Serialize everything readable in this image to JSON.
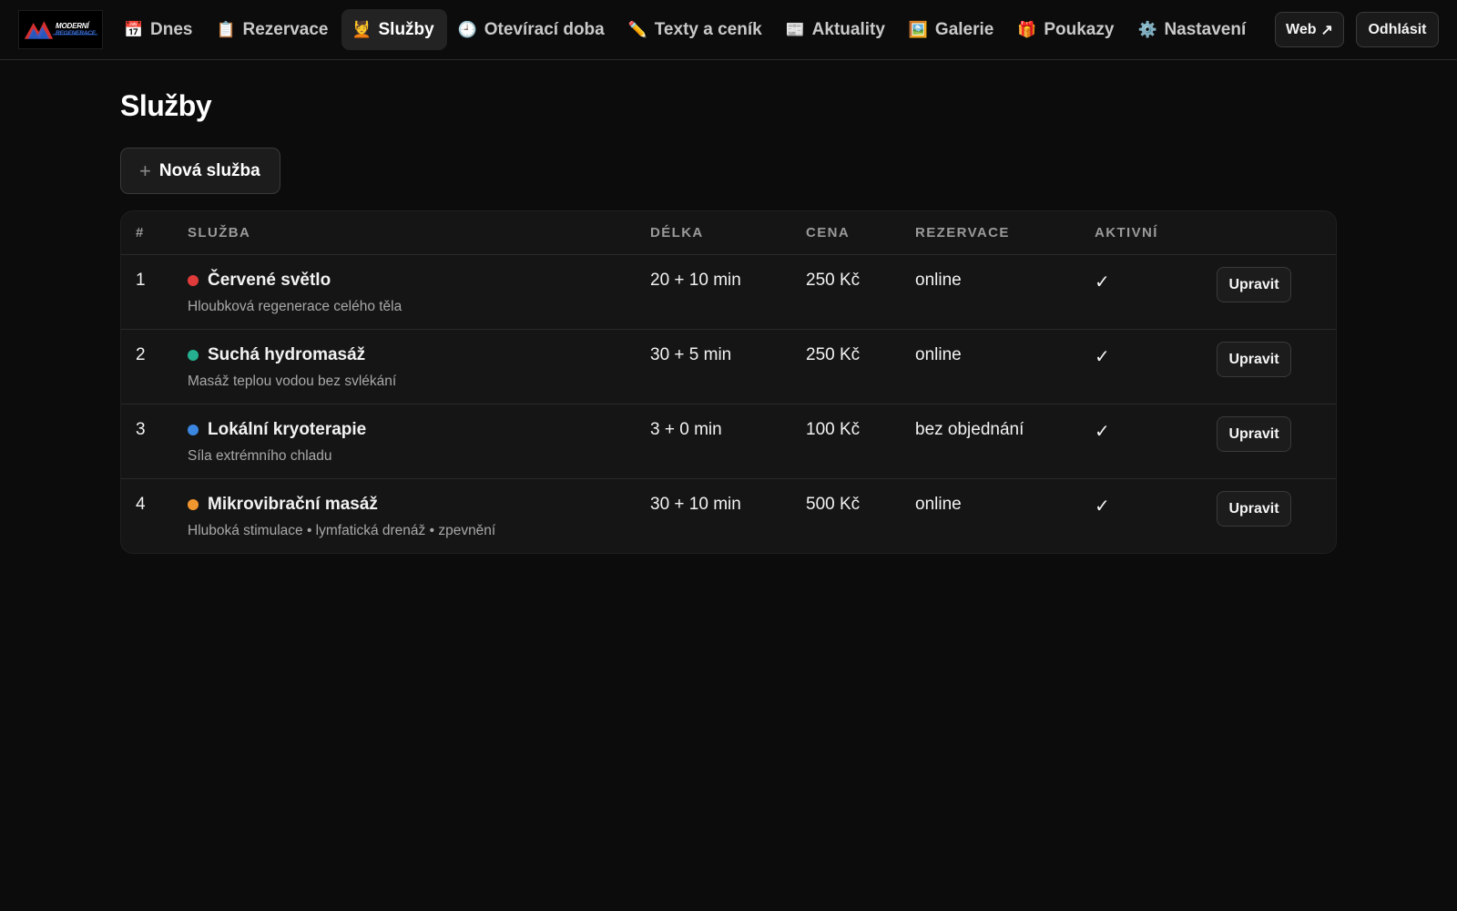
{
  "nav": {
    "logo": {
      "line1": "MODERNÍ",
      "line2": "REGENERACE"
    },
    "items": [
      {
        "icon": "calendar-icon",
        "glyph": "📅",
        "label": "Dnes",
        "active": false
      },
      {
        "icon": "clipboard-icon",
        "glyph": "📋",
        "label": "Rezervace",
        "active": false
      },
      {
        "icon": "person-icon",
        "glyph": "💆",
        "label": "Služby",
        "active": true
      },
      {
        "icon": "clock-icon",
        "glyph": "🕘",
        "label": "Otevírací doba",
        "active": false
      },
      {
        "icon": "pencil-icon",
        "glyph": "✏️",
        "label": "Texty a ceník",
        "active": false
      },
      {
        "icon": "newspaper-icon",
        "glyph": "📰",
        "label": "Aktuality",
        "active": false
      },
      {
        "icon": "picture-icon",
        "glyph": "🖼️",
        "label": "Galerie",
        "active": false
      },
      {
        "icon": "gift-icon",
        "glyph": "🎁",
        "label": "Poukazy",
        "active": false
      },
      {
        "icon": "gear-icon",
        "glyph": "⚙️",
        "label": "Nastavení",
        "active": false
      }
    ],
    "web_label": "Web",
    "web_icon": "↗",
    "logout_label": "Odhlásit"
  },
  "page": {
    "title": "Služby",
    "new_button": "Nová služba",
    "new_button_icon": "+"
  },
  "table": {
    "headers": {
      "num": "#",
      "name": "SLUŽBA",
      "length": "DÉLKA",
      "price": "CENA",
      "reservation": "REZERVACE",
      "active": "AKTIVNÍ"
    },
    "rows": [
      {
        "num": "1",
        "name": "Červené světlo",
        "desc": "Hloubková regenerace celého těla",
        "length": "20 + 10 min",
        "price": "250 Kč",
        "reservation": "online",
        "active": "✓",
        "color": "#e03b3b",
        "edit": "Upravit"
      },
      {
        "num": "2",
        "name": "Suchá hydromasáž",
        "desc": "Masáž teplou vodou bez svlékání",
        "length": "30 + 5 min",
        "price": "250 Kč",
        "reservation": "online",
        "active": "✓",
        "color": "#25b08f",
        "edit": "Upravit"
      },
      {
        "num": "3",
        "name": "Lokální kryoterapie",
        "desc": "Síla extrémního chladu",
        "length": "3 + 0 min",
        "price": "100 Kč",
        "reservation": "bez objednání",
        "active": "✓",
        "color": "#3b86e0",
        "edit": "Upravit"
      },
      {
        "num": "4",
        "name": "Mikrovibrační masáž",
        "desc": "Hluboká stimulace • lymfatická drenáž • zpevnění",
        "length": "30 + 10 min",
        "price": "500 Kč",
        "reservation": "online",
        "active": "✓",
        "color": "#f0962e",
        "edit": "Upravit"
      }
    ]
  }
}
